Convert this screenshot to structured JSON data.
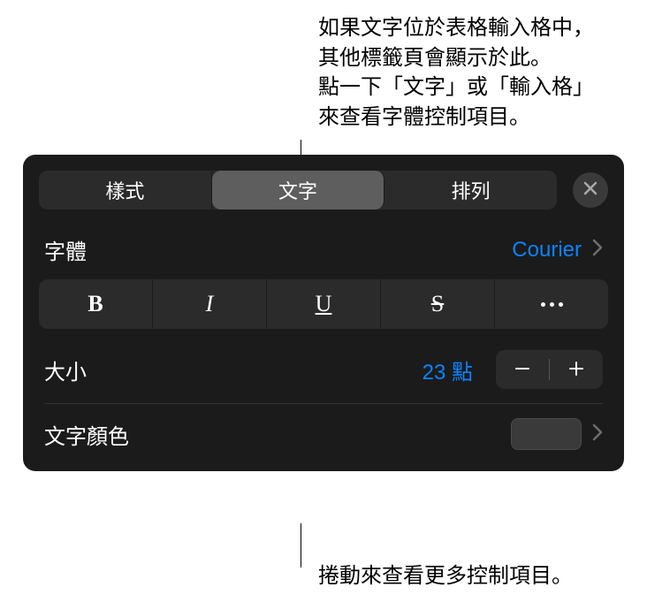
{
  "annotations": {
    "top": "如果文字位於表格輸入格中，\n其他標籤頁會顯示於此。\n點一下「文字」或「輸入格」\n來查看字體控制項目。",
    "bottom": "捲動來查看更多控制項目。"
  },
  "tabs": {
    "items": [
      "樣式",
      "文字",
      "排列"
    ],
    "active_index": 1
  },
  "font": {
    "label": "字體",
    "value": "Courier"
  },
  "style_buttons": {
    "bold": "B",
    "italic": "I",
    "underline": "U",
    "strike": "S"
  },
  "size": {
    "label": "大小",
    "value": "23 點"
  },
  "text_color": {
    "label": "文字顏色",
    "swatch_color": "#3a3a3a"
  }
}
